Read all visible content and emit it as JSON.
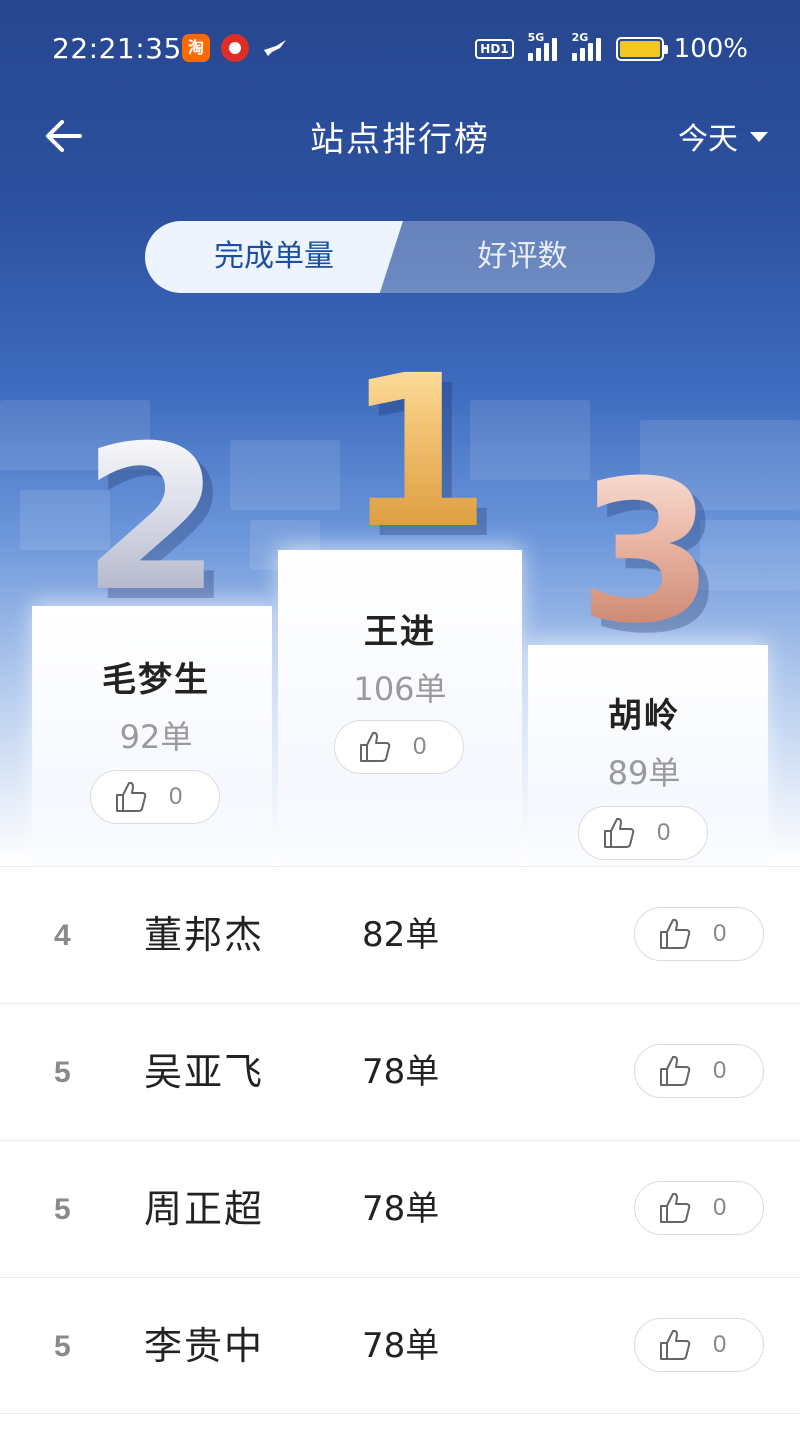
{
  "status_bar": {
    "time": "22:21:35",
    "taobao_glyph": "淘",
    "hd_label": "HD1",
    "signal_1_label": "5G",
    "signal_2_label": "2G",
    "battery_text": "100%",
    "battery_color": "#f3c623",
    "icons": [
      "taobao-app-icon",
      "pin-app-icon",
      "bird-app-icon",
      "signal-icon",
      "battery-icon"
    ]
  },
  "navbar": {
    "title": "站点排行榜",
    "filter_label": "今天",
    "back_icon": "arrow-left-icon"
  },
  "tabs": [
    {
      "label": "完成单量",
      "active": true
    },
    {
      "label": "好评数",
      "active": false
    }
  ],
  "podium": {
    "first": {
      "rank_digit": "1",
      "name": "王进",
      "count": "106单",
      "likes": "0"
    },
    "second": {
      "rank_digit": "2",
      "name": "毛梦生",
      "count": "92单",
      "likes": "0"
    },
    "third": {
      "rank_digit": "3",
      "name": "胡岭",
      "count": "89单",
      "likes": "0"
    }
  },
  "ranking_list": [
    {
      "rank": "4",
      "name": "董邦杰",
      "count": "82单",
      "likes": "0"
    },
    {
      "rank": "5",
      "name": "吴亚飞",
      "count": "78单",
      "likes": "0"
    },
    {
      "rank": "5",
      "name": "周正超",
      "count": "78单",
      "likes": "0"
    },
    {
      "rank": "5",
      "name": "李贵中",
      "count": "78单",
      "likes": "0"
    }
  ],
  "colors": {
    "header_blue": "#27468f",
    "active_tab_text": "#1c4fa1",
    "gold": "#e7b35a",
    "silver": "#c6c8d6",
    "bronze": "#e0a18b"
  }
}
